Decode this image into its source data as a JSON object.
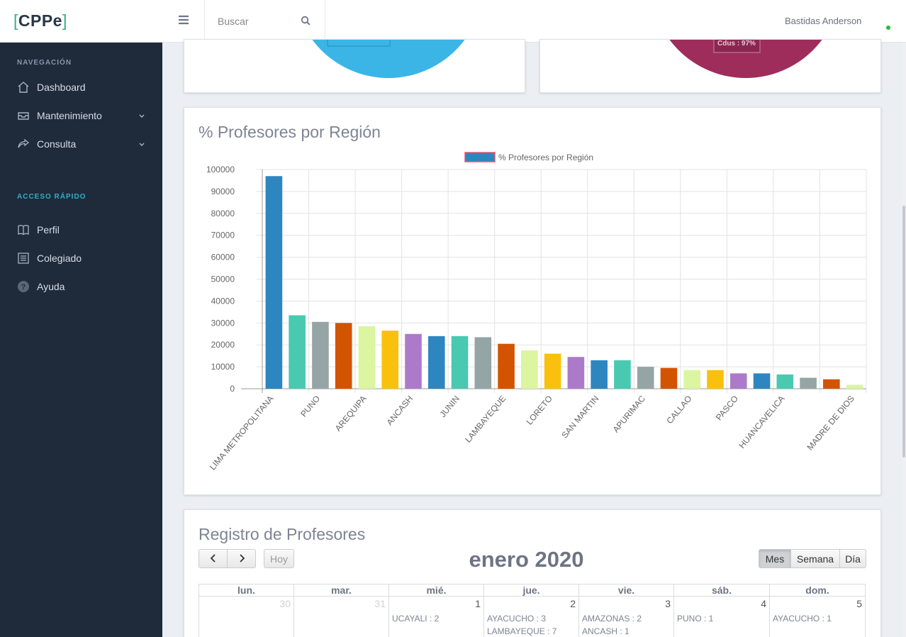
{
  "app": {
    "logo_text": "CPPe",
    "logo_bracket_open": "[",
    "logo_bracket_close": "]"
  },
  "topbar": {
    "search_placeholder": "Buscar",
    "user_name": "Bastidas Anderson"
  },
  "sidebar": {
    "section_nav": "NAVEGACIÓN",
    "section_quick": "ACCESO RÁPIDO",
    "items": [
      {
        "label": "Dashboard",
        "icon": "home-icon"
      },
      {
        "label": "Mantenimiento",
        "icon": "inbox-icon"
      },
      {
        "label": "Consulta",
        "icon": "share-icon"
      },
      {
        "label": "Perfil",
        "icon": "book-icon"
      },
      {
        "label": "Colegiado",
        "icon": "list-icon"
      },
      {
        "label": "Ayuda",
        "icon": "help-icon"
      }
    ],
    "colors": {
      "bg": "#1f2a3b",
      "section_nav": "#8a95a6",
      "section_quick": "#2fb0c5"
    }
  },
  "top_panels": {
    "left_pie_color": "#3ab5e6",
    "right_pie_color": "#9e2d5c",
    "right_pie_label": "Cdus : 97%"
  },
  "chart_panel": {
    "title": "% Profesores por Región"
  },
  "chart_data": {
    "type": "bar",
    "legend_label": "% Profesores por Región",
    "ylim": [
      0,
      100000
    ],
    "yticks": [
      0,
      10000,
      20000,
      30000,
      40000,
      50000,
      60000,
      70000,
      80000,
      90000,
      100000
    ],
    "categories": [
      "LIMA METROPOLITANA",
      "",
      "PUNO",
      "",
      "AREQUIPA",
      "",
      "ANCASH",
      "",
      "JUNIN",
      "",
      "LAMBAYEQUE",
      "",
      "LORETO",
      "",
      "SAN MARTIN",
      "",
      "APURIMAC",
      "",
      "CALLAO",
      "",
      "PASCO",
      "",
      "HUANCAVELICA",
      "",
      "",
      "MADRE DE DIOS"
    ],
    "values": [
      97000,
      33500,
      30500,
      30000,
      28500,
      26500,
      25000,
      24000,
      24000,
      23500,
      20500,
      17500,
      16000,
      14500,
      13000,
      13000,
      10000,
      9500,
      8500,
      8500,
      7000,
      7000,
      6500,
      5000,
      4300,
      1800
    ],
    "colors": [
      "#2e86c1",
      "#48c9b0",
      "#95a5a6",
      "#d35400",
      "#dbf5a0",
      "#f9c10e",
      "#ad7ac9",
      "#2e86c1",
      "#48c9b0",
      "#95a5a6",
      "#d35400",
      "#dbf5a0",
      "#f9c10e",
      "#ad7ac9",
      "#2e86c1",
      "#48c9b0",
      "#95a5a6",
      "#d35400",
      "#dbf5a0",
      "#f9c10e",
      "#ad7ac9",
      "#2e86c1",
      "#48c9b0",
      "#95a5a6",
      "#d35400",
      "#dbf5a0"
    ]
  },
  "calendar": {
    "title": "Registro de Profesores",
    "month_label": "enero 2020",
    "prev_icon": "chevron-left-icon",
    "next_icon": "chevron-right-icon",
    "today_label": "Hoy",
    "views": [
      "Mes",
      "Semana",
      "Día"
    ],
    "active_view": "Mes",
    "weekdays": [
      "lun.",
      "mar.",
      "mié.",
      "jue.",
      "vie.",
      "sáb.",
      "dom."
    ],
    "days": [
      {
        "num": "30",
        "other": true,
        "events": []
      },
      {
        "num": "31",
        "other": true,
        "events": []
      },
      {
        "num": "1",
        "other": false,
        "events": [
          "UCAYALI : 2"
        ]
      },
      {
        "num": "2",
        "other": false,
        "events": [
          "AYACUCHO : 3",
          "LAMBAYEQUE : 7"
        ]
      },
      {
        "num": "3",
        "other": false,
        "events": [
          "AMAZONAS : 2",
          "ANCASH : 1"
        ]
      },
      {
        "num": "4",
        "other": false,
        "events": [
          "PUNO : 1"
        ]
      },
      {
        "num": "5",
        "other": false,
        "events": [
          "AYACUCHO : 1"
        ]
      }
    ]
  }
}
